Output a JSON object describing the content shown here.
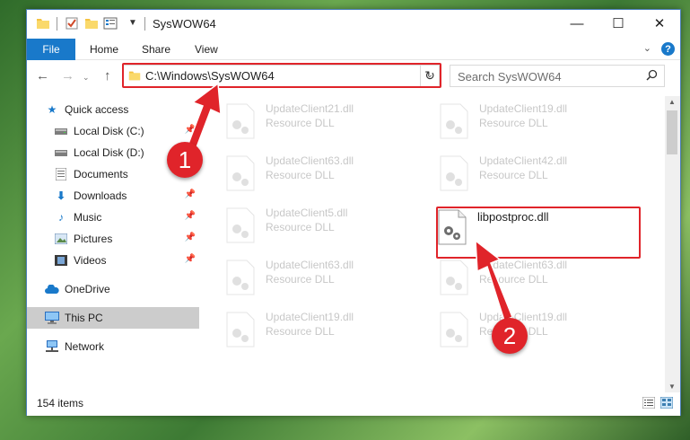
{
  "window": {
    "title": "SysWOW64",
    "controls": {
      "minimize": "—",
      "maximize": "☐",
      "close": "✕"
    }
  },
  "ribbon": {
    "tabs": [
      {
        "label": "File"
      },
      {
        "label": "Home"
      },
      {
        "label": "Share"
      },
      {
        "label": "View"
      }
    ],
    "help": "?"
  },
  "nav": {
    "address": "C:\\Windows\\SysWOW64",
    "search_placeholder": "Search SysWOW64"
  },
  "sidebar": {
    "items": [
      {
        "label": "Quick access",
        "icon": "star-icon",
        "pinned": false
      },
      {
        "label": "Local Disk (C:)",
        "icon": "drive-icon",
        "pinned": true
      },
      {
        "label": "Local Disk (D:)",
        "icon": "drive-icon",
        "pinned": false
      },
      {
        "label": "Documents",
        "icon": "documents-icon",
        "pinned": false
      },
      {
        "label": "Downloads",
        "icon": "download-icon",
        "pinned": true
      },
      {
        "label": "Music",
        "icon": "music-icon",
        "pinned": true
      },
      {
        "label": "Pictures",
        "icon": "pictures-icon",
        "pinned": true
      },
      {
        "label": "Videos",
        "icon": "videos-icon",
        "pinned": true
      },
      {
        "label": "OneDrive",
        "icon": "cloud-icon",
        "pinned": false
      },
      {
        "label": "This PC",
        "icon": "computer-icon",
        "pinned": false,
        "selected": true
      },
      {
        "label": "Network",
        "icon": "network-icon",
        "pinned": false
      }
    ]
  },
  "files": {
    "left": [
      {
        "name": "UpdateClient21.dll",
        "type": "Resource DLL"
      },
      {
        "name": "UpdateClient63.dll",
        "type": "Resource DLL"
      },
      {
        "name": "UpdateClient5.dll",
        "type": "Resource DLL"
      },
      {
        "name": "UpdateClient63.dll",
        "type": "Resource DLL"
      },
      {
        "name": "UpdateClient19.dll",
        "type": "Resource DLL"
      }
    ],
    "right": [
      {
        "name": "UpdateClient19.dll",
        "type": "Resource DLL"
      },
      {
        "name": "UpdateClient42.dll",
        "type": "Resource DLL"
      },
      {
        "name": "libpostproc.dll",
        "type": ""
      },
      {
        "name": "UpdateClient63.dll",
        "type": "Resource DLL"
      },
      {
        "name": "UpdateClient19.dll",
        "type": "Resource DLL"
      }
    ]
  },
  "status": {
    "count": "154 items"
  },
  "annotations": {
    "step1": "1",
    "step2": "2"
  },
  "colors": {
    "accent": "#1979ca",
    "highlight": "#e0242a"
  }
}
